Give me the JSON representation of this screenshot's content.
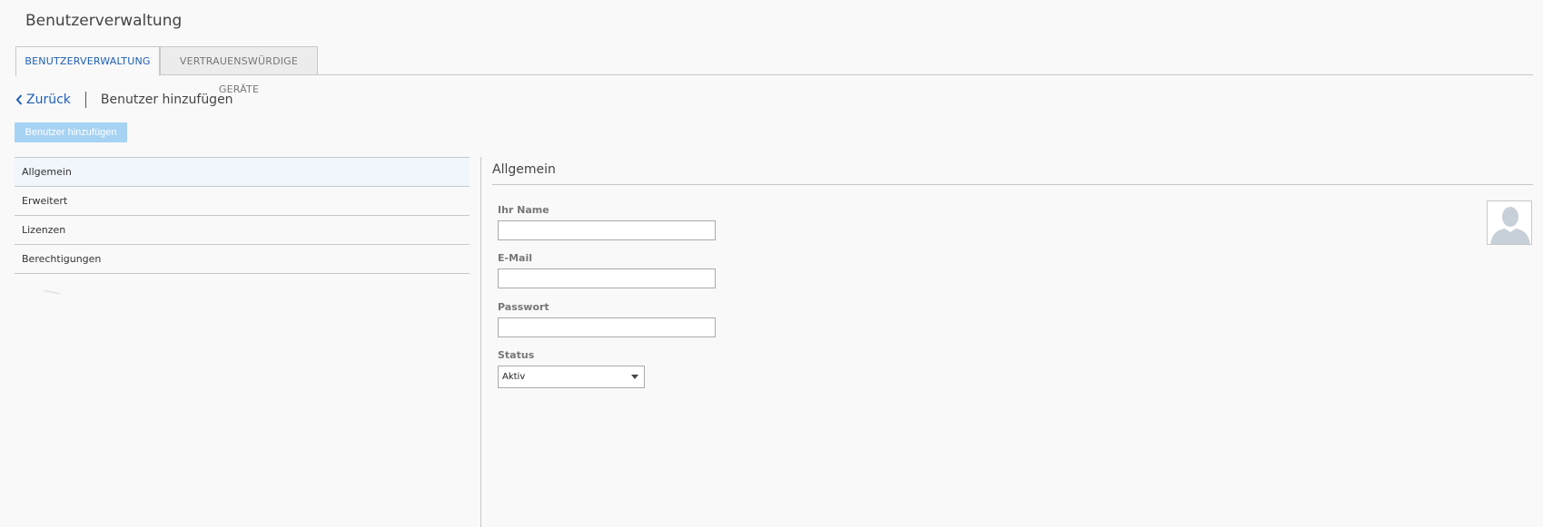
{
  "page": {
    "title": "Benutzerverwaltung"
  },
  "tabs": [
    {
      "label": "BENUTZERVERWALTUNG",
      "active": true
    },
    {
      "label": "VERTRAUENSWÜRDIGE GERÄTE",
      "active": false
    }
  ],
  "backbar": {
    "back_label": "Zurück",
    "title": "Benutzer hinzufügen"
  },
  "toolbar": {
    "add_user_label": "Benutzer hinzufügen"
  },
  "sidebar": {
    "items": [
      {
        "label": "Allgemein",
        "active": true
      },
      {
        "label": "Erweitert",
        "active": false
      },
      {
        "label": "Lizenzen",
        "active": false
      },
      {
        "label": "Berechtigungen",
        "active": false
      }
    ]
  },
  "form": {
    "section_title": "Allgemein",
    "name": {
      "label": "Ihr Name",
      "value": ""
    },
    "email": {
      "label": "E-Mail",
      "value": ""
    },
    "password": {
      "label": "Passwort",
      "value": ""
    },
    "status": {
      "label": "Status",
      "value": "Aktiv"
    }
  },
  "icons": {
    "back": "chevron-left-icon",
    "avatar": "user-placeholder-icon",
    "dropdown": "caret-down-icon"
  },
  "colors": {
    "accent": "#1e5fb4",
    "button_disabled": "#a6d2f3",
    "border": "#c8c8c8"
  }
}
